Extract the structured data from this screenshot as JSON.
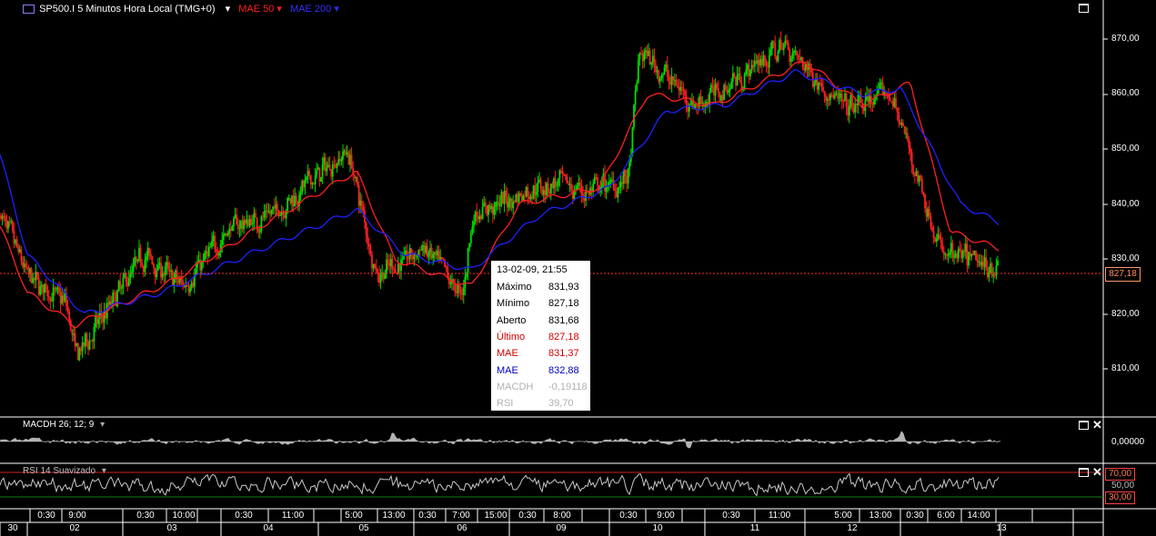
{
  "header": {
    "symbol": "SP500.I 5 Minutos Hora Local (TMG+0)",
    "mae50": "MAE 50",
    "mae200": "MAE 200"
  },
  "colors": {
    "background": "#000000",
    "candle_up": "#00dd00",
    "candle_down": "#ff2020",
    "mae50": "#ff2020",
    "mae200": "#2020ff",
    "price_line": "#ff3030",
    "panel_gray": "#b4b4b4"
  },
  "price_axis": {
    "labels": [
      "870,00",
      "860,00",
      "850,00",
      "840,00",
      "830,00",
      "820,00",
      "810,00"
    ],
    "current_price": "827,18"
  },
  "tooltip": {
    "datetime": "13-02-09, 21:55",
    "rows": [
      {
        "label": "Máximo",
        "value": "831,93",
        "color": "#000000"
      },
      {
        "label": "Mínimo",
        "value": "827,18",
        "color": "#000000"
      },
      {
        "label": "Aberto",
        "value": "831,68",
        "color": "#000000"
      },
      {
        "label": "Último",
        "value": "827,18",
        "color": "#d00000"
      },
      {
        "label": "MAE",
        "value": "831,37",
        "color": "#d00000"
      },
      {
        "label": "MAE",
        "value": "832,88",
        "color": "#0000c0"
      },
      {
        "label": "MACDH",
        "value": "-0,19118",
        "color": "#b0b0b0"
      },
      {
        "label": "RSI",
        "value": "39,70",
        "color": "#b0b0b0"
      }
    ]
  },
  "macd_panel": {
    "title": "MACDH 26; 12; 9",
    "axis_label": "0,00000"
  },
  "rsi_panel": {
    "title": "RSI 14 Suavizado",
    "upper": "70,00",
    "mid": "50,00",
    "lower": "30,00"
  },
  "time_axis": {
    "times": [
      "0:30",
      "9:00",
      "0:30",
      "10:00",
      "0:30",
      "11:00",
      "5:00",
      "13:00",
      "0:30",
      "7:00",
      "15:00",
      "0:30",
      "8:00",
      "0:30",
      "9:00",
      "0:30",
      "11:00",
      "5:00",
      "13:00",
      "0:30",
      "6:00",
      "14:00"
    ],
    "dates": [
      "30",
      "02",
      "03",
      "04",
      "05",
      "06",
      "09",
      "10",
      "11",
      "12",
      "13"
    ]
  },
  "chart_data": {
    "type": "candlestick",
    "title": "SP500.I 5 Minutos",
    "ylim": [
      805,
      875
    ],
    "x_dates": [
      "30",
      "02",
      "03",
      "04",
      "05",
      "06",
      "09",
      "10",
      "11",
      "12",
      "13"
    ],
    "series": [
      {
        "name": "SP500.I",
        "keypoints": [
          [
            0,
            838
          ],
          [
            1.4,
            822
          ],
          [
            1.5,
            812
          ],
          [
            2.2,
            831
          ],
          [
            2.6,
            825
          ],
          [
            3.1,
            836
          ],
          [
            3.5,
            838
          ],
          [
            4.3,
            850
          ],
          [
            4.6,
            827
          ],
          [
            5.1,
            832
          ],
          [
            5.5,
            823
          ],
          [
            5.6,
            838
          ],
          [
            6.4,
            844
          ],
          [
            6.8,
            842
          ],
          [
            7.2,
            845
          ],
          [
            7.3,
            868
          ],
          [
            7.9,
            858
          ],
          [
            8.8,
            869
          ],
          [
            9.4,
            857
          ],
          [
            9.9,
            860
          ],
          [
            10.4,
            831
          ],
          [
            10.9,
            829
          ],
          [
            11.5,
            831
          ],
          [
            12.3,
            830
          ],
          [
            12.7,
            822
          ],
          [
            12.85,
            812
          ],
          [
            13.2,
            838
          ],
          [
            13.8,
            840
          ],
          [
            14.1,
            832
          ],
          [
            14.2,
            827.18
          ]
        ]
      },
      {
        "name": "MAE 50",
        "keypoints": [
          [
            0,
            836
          ],
          [
            1.5,
            818
          ],
          [
            2.5,
            826
          ],
          [
            3.5,
            837
          ],
          [
            4.4,
            846
          ],
          [
            4.8,
            830
          ],
          [
            5.6,
            825
          ],
          [
            6.1,
            840
          ],
          [
            6.9,
            843
          ],
          [
            7.4,
            860
          ],
          [
            8.1,
            858
          ],
          [
            9.0,
            866
          ],
          [
            9.6,
            858
          ],
          [
            10.1,
            862
          ],
          [
            10.5,
            835
          ],
          [
            11.3,
            830
          ],
          [
            12.2,
            829
          ],
          [
            12.8,
            818
          ],
          [
            13.2,
            835
          ],
          [
            13.9,
            836
          ],
          [
            14.2,
            831.37
          ]
        ]
      },
      {
        "name": "MAE 200",
        "keypoints": [
          [
            0,
            849
          ],
          [
            1.6,
            820
          ],
          [
            2.4,
            824
          ],
          [
            3.3,
            831
          ],
          [
            4.4,
            839
          ],
          [
            4.9,
            831
          ],
          [
            5.6,
            828
          ],
          [
            6.3,
            838
          ],
          [
            7.0,
            843
          ],
          [
            7.6,
            857
          ],
          [
            8.2,
            858
          ],
          [
            8.9,
            864
          ],
          [
            9.6,
            860
          ],
          [
            10.0,
            861
          ],
          [
            10.6,
            840
          ],
          [
            11.3,
            834
          ],
          [
            12.2,
            829
          ],
          [
            12.8,
            823
          ],
          [
            13.2,
            830
          ],
          [
            13.9,
            835
          ],
          [
            14.2,
            832.88
          ]
        ]
      }
    ]
  }
}
